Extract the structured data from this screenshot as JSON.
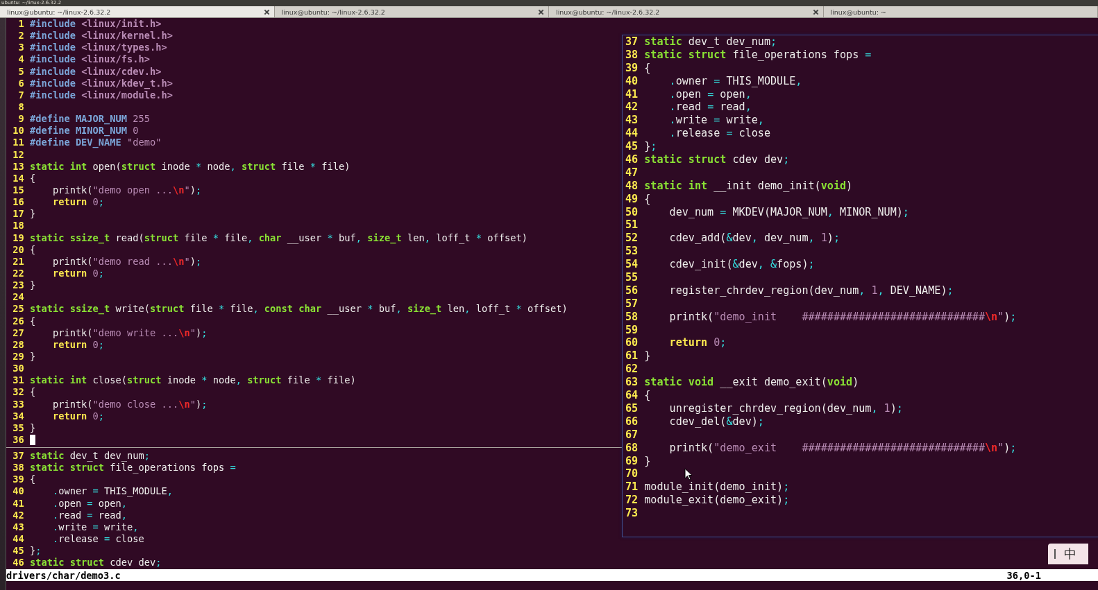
{
  "system_bar": {
    "title": "ubuntu: ~/linux-2.6.32.2"
  },
  "tabs": [
    {
      "label": "linux@ubuntu: ~/linux-2.6.32.2",
      "selected": true,
      "closable": true
    },
    {
      "label": "linux@ubuntu: ~/linux-2.6.32.2",
      "selected": false,
      "closable": true
    },
    {
      "label": "linux@ubuntu: ~/linux-2.6.32.2",
      "selected": false,
      "closable": true
    },
    {
      "label": "linux@ubuntu: ~",
      "selected": false,
      "closable": false
    }
  ],
  "editor": {
    "upper_pane": {
      "lines": [
        {
          "num": "1",
          "tokens": [
            {
              "kind": "pre",
              "text": "#include"
            },
            {
              "kind": "hdr",
              "text": " <linux/init.h>"
            }
          ]
        },
        {
          "num": "2",
          "tokens": [
            {
              "kind": "pre",
              "text": "#include"
            },
            {
              "kind": "hdr",
              "text": " <linux/kernel.h>"
            }
          ]
        },
        {
          "num": "3",
          "tokens": [
            {
              "kind": "pre",
              "text": "#include"
            },
            {
              "kind": "hdr",
              "text": " <linux/types.h>"
            }
          ]
        },
        {
          "num": "4",
          "tokens": [
            {
              "kind": "pre",
              "text": "#include"
            },
            {
              "kind": "hdr",
              "text": " <linux/fs.h>"
            }
          ]
        },
        {
          "num": "5",
          "tokens": [
            {
              "kind": "pre",
              "text": "#include"
            },
            {
              "kind": "hdr",
              "text": " <linux/cdev.h>"
            }
          ]
        },
        {
          "num": "6",
          "tokens": [
            {
              "kind": "pre",
              "text": "#include"
            },
            {
              "kind": "hdr",
              "text": " <linux/kdev_t.h>"
            }
          ]
        },
        {
          "num": "7",
          "tokens": [
            {
              "kind": "pre",
              "text": "#include"
            },
            {
              "kind": "hdr",
              "text": " <linux/module.h>"
            }
          ]
        },
        {
          "num": "8"
        },
        {
          "num": "9",
          "tokens": [
            {
              "kind": "pre",
              "text": "#define MAJOR_NUM"
            },
            {
              "kind": "num",
              "text": " 255"
            }
          ]
        },
        {
          "num": "10",
          "tokens": [
            {
              "kind": "pre",
              "text": "#define MINOR_NUM"
            },
            {
              "kind": "num",
              "text": " 0"
            }
          ]
        },
        {
          "num": "11",
          "tokens": [
            {
              "kind": "pre",
              "text": "#define DEV_NAME"
            },
            {
              "kind": "str",
              "text": " \"demo\""
            }
          ]
        },
        {
          "num": "12"
        },
        {
          "num": "13",
          "tokens": [
            {
              "kind": "kw",
              "text": "static int"
            },
            {
              "kind": "id",
              "text": " open("
            },
            {
              "kind": "kw",
              "text": "struct"
            },
            {
              "kind": "id",
              "text": " inode "
            },
            {
              "kind": "op",
              "text": "*"
            },
            {
              "kind": "id",
              "text": " node"
            },
            {
              "kind": "op",
              "text": ", "
            },
            {
              "kind": "kw",
              "text": "struct"
            },
            {
              "kind": "id",
              "text": " file "
            },
            {
              "kind": "op",
              "text": "*"
            },
            {
              "kind": "id",
              "text": " file)"
            }
          ]
        },
        {
          "num": "14",
          "tokens": [
            {
              "kind": "id",
              "text": "{"
            }
          ]
        },
        {
          "num": "15",
          "tokens": [
            {
              "kind": "id",
              "text": "    printk("
            },
            {
              "kind": "str",
              "text": "\"demo open ..."
            },
            {
              "kind": "esc",
              "text": "\\n"
            },
            {
              "kind": "str",
              "text": "\""
            },
            {
              "kind": "id",
              "text": ")"
            },
            {
              "kind": "op",
              "text": ";"
            }
          ]
        },
        {
          "num": "16",
          "tokens": [
            {
              "kind": "ret",
              "text": "    return"
            },
            {
              "kind": "num",
              "text": " 0"
            },
            {
              "kind": "op",
              "text": ";"
            }
          ]
        },
        {
          "num": "17",
          "tokens": [
            {
              "kind": "id",
              "text": "}"
            }
          ]
        },
        {
          "num": "18"
        },
        {
          "num": "19",
          "tokens": [
            {
              "kind": "kw",
              "text": "static ssize_t"
            },
            {
              "kind": "id",
              "text": " read("
            },
            {
              "kind": "kw",
              "text": "struct"
            },
            {
              "kind": "id",
              "text": " file "
            },
            {
              "kind": "op",
              "text": "*"
            },
            {
              "kind": "id",
              "text": " file"
            },
            {
              "kind": "op",
              "text": ", "
            },
            {
              "kind": "kw",
              "text": "char"
            },
            {
              "kind": "id",
              "text": " __user "
            },
            {
              "kind": "op",
              "text": "*"
            },
            {
              "kind": "id",
              "text": " buf"
            },
            {
              "kind": "op",
              "text": ", "
            },
            {
              "kind": "kw",
              "text": "size_t"
            },
            {
              "kind": "id",
              "text": " len"
            },
            {
              "kind": "op",
              "text": ","
            },
            {
              "kind": "id",
              "text": " loff_t "
            },
            {
              "kind": "op",
              "text": "*"
            },
            {
              "kind": "id",
              "text": " offset)"
            }
          ]
        },
        {
          "num": "20",
          "tokens": [
            {
              "kind": "id",
              "text": "{"
            }
          ]
        },
        {
          "num": "21",
          "tokens": [
            {
              "kind": "id",
              "text": "    printk("
            },
            {
              "kind": "str",
              "text": "\"demo read ..."
            },
            {
              "kind": "esc",
              "text": "\\n"
            },
            {
              "kind": "str",
              "text": "\""
            },
            {
              "kind": "id",
              "text": ")"
            },
            {
              "kind": "op",
              "text": ";"
            }
          ]
        },
        {
          "num": "22",
          "tokens": [
            {
              "kind": "ret",
              "text": "    return"
            },
            {
              "kind": "num",
              "text": " 0"
            },
            {
              "kind": "op",
              "text": ";"
            }
          ]
        },
        {
          "num": "23",
          "tokens": [
            {
              "kind": "id",
              "text": "}"
            }
          ]
        },
        {
          "num": "24"
        },
        {
          "num": "25",
          "tokens": [
            {
              "kind": "kw",
              "text": "static ssize_t"
            },
            {
              "kind": "id",
              "text": " write("
            },
            {
              "kind": "kw",
              "text": "struct"
            },
            {
              "kind": "id",
              "text": " file "
            },
            {
              "kind": "op",
              "text": "*"
            },
            {
              "kind": "id",
              "text": " file"
            },
            {
              "kind": "op",
              "text": ", "
            },
            {
              "kind": "kw",
              "text": "const char"
            },
            {
              "kind": "id",
              "text": " __user "
            },
            {
              "kind": "op",
              "text": "*"
            },
            {
              "kind": "id",
              "text": " buf"
            },
            {
              "kind": "op",
              "text": ", "
            },
            {
              "kind": "kw",
              "text": "size_t"
            },
            {
              "kind": "id",
              "text": " len"
            },
            {
              "kind": "op",
              "text": ","
            },
            {
              "kind": "id",
              "text": " loff_t "
            },
            {
              "kind": "op",
              "text": "*"
            },
            {
              "kind": "id",
              "text": " offset)"
            }
          ]
        },
        {
          "num": "26",
          "tokens": [
            {
              "kind": "id",
              "text": "{"
            }
          ]
        },
        {
          "num": "27",
          "tokens": [
            {
              "kind": "id",
              "text": "    printk("
            },
            {
              "kind": "str",
              "text": "\"demo write ..."
            },
            {
              "kind": "esc",
              "text": "\\n"
            },
            {
              "kind": "str",
              "text": "\""
            },
            {
              "kind": "id",
              "text": ")"
            },
            {
              "kind": "op",
              "text": ";"
            }
          ]
        },
        {
          "num": "28",
          "tokens": [
            {
              "kind": "ret",
              "text": "    return"
            },
            {
              "kind": "num",
              "text": " 0"
            },
            {
              "kind": "op",
              "text": ";"
            }
          ]
        },
        {
          "num": "29",
          "tokens": [
            {
              "kind": "id",
              "text": "}"
            }
          ]
        },
        {
          "num": "30"
        },
        {
          "num": "31",
          "tokens": [
            {
              "kind": "kw",
              "text": "static int"
            },
            {
              "kind": "id",
              "text": " close("
            },
            {
              "kind": "kw",
              "text": "struct"
            },
            {
              "kind": "id",
              "text": " inode "
            },
            {
              "kind": "op",
              "text": "*"
            },
            {
              "kind": "id",
              "text": " node"
            },
            {
              "kind": "op",
              "text": ", "
            },
            {
              "kind": "kw",
              "text": "struct"
            },
            {
              "kind": "id",
              "text": " file "
            },
            {
              "kind": "op",
              "text": "*"
            },
            {
              "kind": "id",
              "text": " file)"
            }
          ]
        },
        {
          "num": "32",
          "tokens": [
            {
              "kind": "id",
              "text": "{"
            }
          ]
        },
        {
          "num": "33",
          "tokens": [
            {
              "kind": "id",
              "text": "    printk("
            },
            {
              "kind": "str",
              "text": "\"demo close ..."
            },
            {
              "kind": "esc",
              "text": "\\n"
            },
            {
              "kind": "str",
              "text": "\""
            },
            {
              "kind": "id",
              "text": ")"
            },
            {
              "kind": "op",
              "text": ";"
            }
          ]
        },
        {
          "num": "34",
          "tokens": [
            {
              "kind": "ret",
              "text": "    return"
            },
            {
              "kind": "num",
              "text": " 0"
            },
            {
              "kind": "op",
              "text": ";"
            }
          ]
        },
        {
          "num": "35",
          "tokens": [
            {
              "kind": "id",
              "text": "}"
            }
          ]
        },
        {
          "num": "36",
          "cursor": true
        }
      ]
    },
    "lower_pane": {
      "lines": [
        {
          "num": "37",
          "tokens": [
            {
              "kind": "kw",
              "text": "static"
            },
            {
              "kind": "id",
              "text": " dev_t dev_num"
            },
            {
              "kind": "op",
              "text": ";"
            }
          ]
        },
        {
          "num": "38",
          "tokens": [
            {
              "kind": "kw",
              "text": "static struct"
            },
            {
              "kind": "id",
              "text": " file_operations fops "
            },
            {
              "kind": "op",
              "text": "="
            }
          ]
        },
        {
          "num": "39",
          "tokens": [
            {
              "kind": "id",
              "text": "{"
            }
          ]
        },
        {
          "num": "40",
          "tokens": [
            {
              "kind": "op",
              "text": "    ."
            },
            {
              "kind": "id",
              "text": "owner "
            },
            {
              "kind": "op",
              "text": "="
            },
            {
              "kind": "id",
              "text": " THIS_MODULE"
            },
            {
              "kind": "op",
              "text": ","
            }
          ]
        },
        {
          "num": "41",
          "tokens": [
            {
              "kind": "op",
              "text": "    ."
            },
            {
              "kind": "id",
              "text": "open "
            },
            {
              "kind": "op",
              "text": "="
            },
            {
              "kind": "id",
              "text": " open"
            },
            {
              "kind": "op",
              "text": ","
            }
          ]
        },
        {
          "num": "42",
          "tokens": [
            {
              "kind": "op",
              "text": "    ."
            },
            {
              "kind": "id",
              "text": "read "
            },
            {
              "kind": "op",
              "text": "="
            },
            {
              "kind": "id",
              "text": " read"
            },
            {
              "kind": "op",
              "text": ","
            }
          ]
        },
        {
          "num": "43",
          "tokens": [
            {
              "kind": "op",
              "text": "    ."
            },
            {
              "kind": "id",
              "text": "write "
            },
            {
              "kind": "op",
              "text": "="
            },
            {
              "kind": "id",
              "text": " write"
            },
            {
              "kind": "op",
              "text": ","
            }
          ]
        },
        {
          "num": "44",
          "tokens": [
            {
              "kind": "op",
              "text": "    ."
            },
            {
              "kind": "id",
              "text": "release "
            },
            {
              "kind": "op",
              "text": "="
            },
            {
              "kind": "id",
              "text": " close"
            }
          ]
        },
        {
          "num": "45",
          "tokens": [
            {
              "kind": "id",
              "text": "}"
            },
            {
              "kind": "op",
              "text": ";"
            }
          ]
        },
        {
          "num": "46",
          "tokens": [
            {
              "kind": "kw",
              "text": "static struct"
            },
            {
              "kind": "id",
              "text": " cdev dev"
            },
            {
              "kind": "op",
              "text": ";"
            }
          ]
        }
      ]
    },
    "status_line": {
      "file": "drivers/char/demo3.c",
      "position": "36,0-1"
    }
  },
  "floating_window": {
    "lines": [
      {
        "num": "37",
        "tokens": [
          {
            "kind": "kw",
            "text": "static"
          },
          {
            "kind": "id",
            "text": " dev_t dev_num"
          },
          {
            "kind": "op",
            "text": ";"
          }
        ]
      },
      {
        "num": "38",
        "tokens": [
          {
            "kind": "kw",
            "text": "static struct"
          },
          {
            "kind": "id",
            "text": " file_operations fops "
          },
          {
            "kind": "op",
            "text": "="
          }
        ]
      },
      {
        "num": "39",
        "tokens": [
          {
            "kind": "id",
            "text": "{"
          }
        ]
      },
      {
        "num": "40",
        "tokens": [
          {
            "kind": "op",
            "text": "    ."
          },
          {
            "kind": "id",
            "text": "owner "
          },
          {
            "kind": "op",
            "text": "="
          },
          {
            "kind": "id",
            "text": " THIS_MODULE"
          },
          {
            "kind": "op",
            "text": ","
          }
        ]
      },
      {
        "num": "41",
        "tokens": [
          {
            "kind": "op",
            "text": "    ."
          },
          {
            "kind": "id",
            "text": "open "
          },
          {
            "kind": "op",
            "text": "="
          },
          {
            "kind": "id",
            "text": " open"
          },
          {
            "kind": "op",
            "text": ","
          }
        ]
      },
      {
        "num": "42",
        "tokens": [
          {
            "kind": "op",
            "text": "    ."
          },
          {
            "kind": "id",
            "text": "read "
          },
          {
            "kind": "op",
            "text": "="
          },
          {
            "kind": "id",
            "text": " read"
          },
          {
            "kind": "op",
            "text": ","
          }
        ]
      },
      {
        "num": "43",
        "tokens": [
          {
            "kind": "op",
            "text": "    ."
          },
          {
            "kind": "id",
            "text": "write "
          },
          {
            "kind": "op",
            "text": "="
          },
          {
            "kind": "id",
            "text": " write"
          },
          {
            "kind": "op",
            "text": ","
          }
        ]
      },
      {
        "num": "44",
        "tokens": [
          {
            "kind": "op",
            "text": "    ."
          },
          {
            "kind": "id",
            "text": "release "
          },
          {
            "kind": "op",
            "text": "="
          },
          {
            "kind": "id",
            "text": " close"
          }
        ]
      },
      {
        "num": "45",
        "tokens": [
          {
            "kind": "id",
            "text": "}"
          },
          {
            "kind": "op",
            "text": ";"
          }
        ]
      },
      {
        "num": "46",
        "tokens": [
          {
            "kind": "kw",
            "text": "static struct"
          },
          {
            "kind": "id",
            "text": " cdev dev"
          },
          {
            "kind": "op",
            "text": ";"
          }
        ]
      },
      {
        "num": "47"
      },
      {
        "num": "48",
        "tokens": [
          {
            "kind": "kw",
            "text": "static int"
          },
          {
            "kind": "id",
            "text": " __init demo_init("
          },
          {
            "kind": "kw",
            "text": "void"
          },
          {
            "kind": "id",
            "text": ")"
          }
        ]
      },
      {
        "num": "49",
        "tokens": [
          {
            "kind": "id",
            "text": "{"
          }
        ]
      },
      {
        "num": "50",
        "tokens": [
          {
            "kind": "id",
            "text": "    dev_num "
          },
          {
            "kind": "op",
            "text": "="
          },
          {
            "kind": "id",
            "text": " MKDEV(MAJOR_NUM"
          },
          {
            "kind": "op",
            "text": ","
          },
          {
            "kind": "id",
            "text": " MINOR_NUM)"
          },
          {
            "kind": "op",
            "text": ";"
          }
        ]
      },
      {
        "num": "51"
      },
      {
        "num": "52",
        "tokens": [
          {
            "kind": "id",
            "text": "    cdev_add("
          },
          {
            "kind": "op",
            "text": "&"
          },
          {
            "kind": "id",
            "text": "dev"
          },
          {
            "kind": "op",
            "text": ","
          },
          {
            "kind": "id",
            "text": " dev_num"
          },
          {
            "kind": "op",
            "text": ","
          },
          {
            "kind": "num",
            "text": " 1"
          },
          {
            "kind": "id",
            "text": ")"
          },
          {
            "kind": "op",
            "text": ";"
          }
        ]
      },
      {
        "num": "53"
      },
      {
        "num": "54",
        "tokens": [
          {
            "kind": "id",
            "text": "    cdev_init("
          },
          {
            "kind": "op",
            "text": "&"
          },
          {
            "kind": "id",
            "text": "dev"
          },
          {
            "kind": "op",
            "text": ", &"
          },
          {
            "kind": "id",
            "text": "fops)"
          },
          {
            "kind": "op",
            "text": ";"
          }
        ]
      },
      {
        "num": "55"
      },
      {
        "num": "56",
        "tokens": [
          {
            "kind": "id",
            "text": "    register_chrdev_region(dev_num"
          },
          {
            "kind": "op",
            "text": ","
          },
          {
            "kind": "num",
            "text": " 1"
          },
          {
            "kind": "op",
            "text": ","
          },
          {
            "kind": "id",
            "text": " DEV_NAME)"
          },
          {
            "kind": "op",
            "text": ";"
          }
        ]
      },
      {
        "num": "57"
      },
      {
        "num": "58",
        "tokens": [
          {
            "kind": "id",
            "text": "    printk("
          },
          {
            "kind": "str",
            "text": "\"demo_init    #############################"
          },
          {
            "kind": "esc",
            "text": "\\n"
          },
          {
            "kind": "str",
            "text": "\""
          },
          {
            "kind": "id",
            "text": ")"
          },
          {
            "kind": "op",
            "text": ";"
          }
        ]
      },
      {
        "num": "59"
      },
      {
        "num": "60",
        "tokens": [
          {
            "kind": "ret",
            "text": "    return"
          },
          {
            "kind": "num",
            "text": " 0"
          },
          {
            "kind": "op",
            "text": ";"
          }
        ]
      },
      {
        "num": "61",
        "tokens": [
          {
            "kind": "id",
            "text": "}"
          }
        ]
      },
      {
        "num": "62"
      },
      {
        "num": "63",
        "tokens": [
          {
            "kind": "kw",
            "text": "static void"
          },
          {
            "kind": "id",
            "text": " __exit demo_exit("
          },
          {
            "kind": "kw",
            "text": "void"
          },
          {
            "kind": "id",
            "text": ")"
          }
        ]
      },
      {
        "num": "64",
        "tokens": [
          {
            "kind": "id",
            "text": "{"
          }
        ]
      },
      {
        "num": "65",
        "tokens": [
          {
            "kind": "id",
            "text": "    unregister_chrdev_region(dev_num"
          },
          {
            "kind": "op",
            "text": ","
          },
          {
            "kind": "num",
            "text": " 1"
          },
          {
            "kind": "id",
            "text": ")"
          },
          {
            "kind": "op",
            "text": ";"
          }
        ]
      },
      {
        "num": "66",
        "tokens": [
          {
            "kind": "id",
            "text": "    cdev_del("
          },
          {
            "kind": "op",
            "text": "&"
          },
          {
            "kind": "id",
            "text": "dev)"
          },
          {
            "kind": "op",
            "text": ";"
          }
        ]
      },
      {
        "num": "67"
      },
      {
        "num": "68",
        "tokens": [
          {
            "kind": "id",
            "text": "    printk("
          },
          {
            "kind": "str",
            "text": "\"demo_exit    #############################"
          },
          {
            "kind": "esc",
            "text": "\\n"
          },
          {
            "kind": "str",
            "text": "\""
          },
          {
            "kind": "id",
            "text": ")"
          },
          {
            "kind": "op",
            "text": ";"
          }
        ]
      },
      {
        "num": "69",
        "tokens": [
          {
            "kind": "id",
            "text": "}"
          }
        ]
      },
      {
        "num": "70"
      },
      {
        "num": "71",
        "tokens": [
          {
            "kind": "id",
            "text": "module_init(demo_init)"
          },
          {
            "kind": "op",
            "text": ";"
          }
        ]
      },
      {
        "num": "72",
        "tokens": [
          {
            "kind": "id",
            "text": "module_exit(demo_exit)"
          },
          {
            "kind": "op",
            "text": ";"
          }
        ]
      },
      {
        "num": "73"
      }
    ]
  },
  "input_method": {
    "label": "中"
  }
}
